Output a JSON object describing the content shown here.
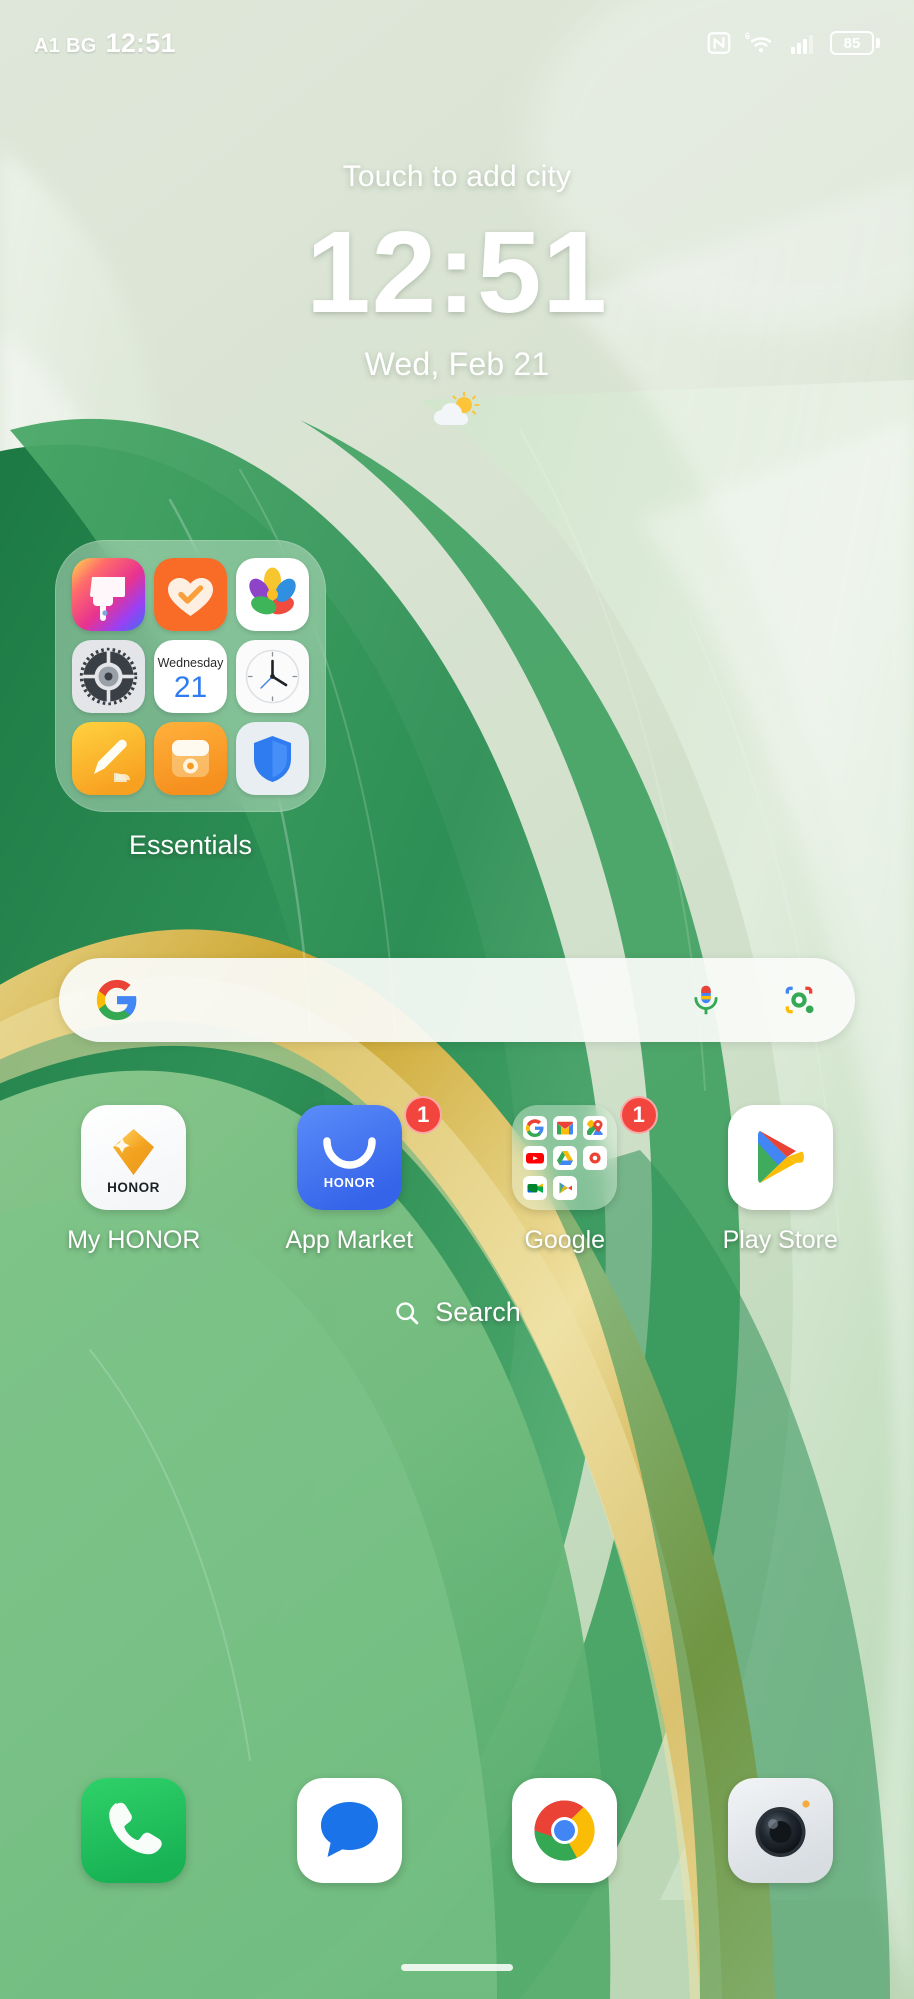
{
  "status_bar": {
    "carrier": "A1 BG",
    "time": "12:51",
    "icons": [
      "nfc-icon",
      "wifi6-icon",
      "signal-bars-icon"
    ],
    "battery_percent": "85"
  },
  "clock_widget": {
    "city_prompt": "Touch to add city",
    "time": "12:51",
    "date": "Wed, Feb 21",
    "weather_icon": "partly-cloudy-icon"
  },
  "folder": {
    "label": "Essentials",
    "apps": [
      {
        "name": "Themes",
        "icon": "themes-paintbrush-icon"
      },
      {
        "name": "Health",
        "icon": "health-heart-icon"
      },
      {
        "name": "Gallery",
        "icon": "gallery-pinwheel-icon"
      },
      {
        "name": "Settings",
        "icon": "settings-gear-icon"
      },
      {
        "name": "Calendar",
        "icon": "calendar-icon",
        "weekday": "Wednesday",
        "day": "21"
      },
      {
        "name": "Clock",
        "icon": "clock-analog-icon"
      },
      {
        "name": "Notes",
        "icon": "notes-pencil-icon"
      },
      {
        "name": "Recorder",
        "icon": "recorder-icon"
      },
      {
        "name": "Security",
        "icon": "security-shield-icon"
      }
    ]
  },
  "google_search": {
    "logo": "google-g-icon",
    "placeholder": "",
    "mic_icon": "microphone-icon",
    "lens_icon": "google-lens-icon"
  },
  "app_row": [
    {
      "label": "My HONOR",
      "icon": "my-honor-diamond-icon",
      "badge": ""
    },
    {
      "label": "App Market",
      "icon": "app-market-icon",
      "badge": "1"
    },
    {
      "label": "Google",
      "icon": "google-folder-icon",
      "badge": "1",
      "mini_apps": [
        "google-search",
        "gmail",
        "maps",
        "youtube",
        "drive",
        "google-photos",
        "meet",
        "google-play-games"
      ]
    },
    {
      "label": "Play Store",
      "icon": "play-store-icon",
      "badge": ""
    }
  ],
  "search_pill": {
    "label": "Search",
    "icon": "search-icon"
  },
  "dock": [
    {
      "label": "Phone",
      "icon": "phone-icon"
    },
    {
      "label": "Messages",
      "icon": "messages-icon"
    },
    {
      "label": "Chrome",
      "icon": "chrome-icon"
    },
    {
      "label": "Camera",
      "icon": "camera-icon"
    }
  ],
  "colors": {
    "accent_green": "#3f9d5c",
    "badge_red": "#f2453d",
    "gold": "#d4af37",
    "text_white": "#ffffff"
  }
}
